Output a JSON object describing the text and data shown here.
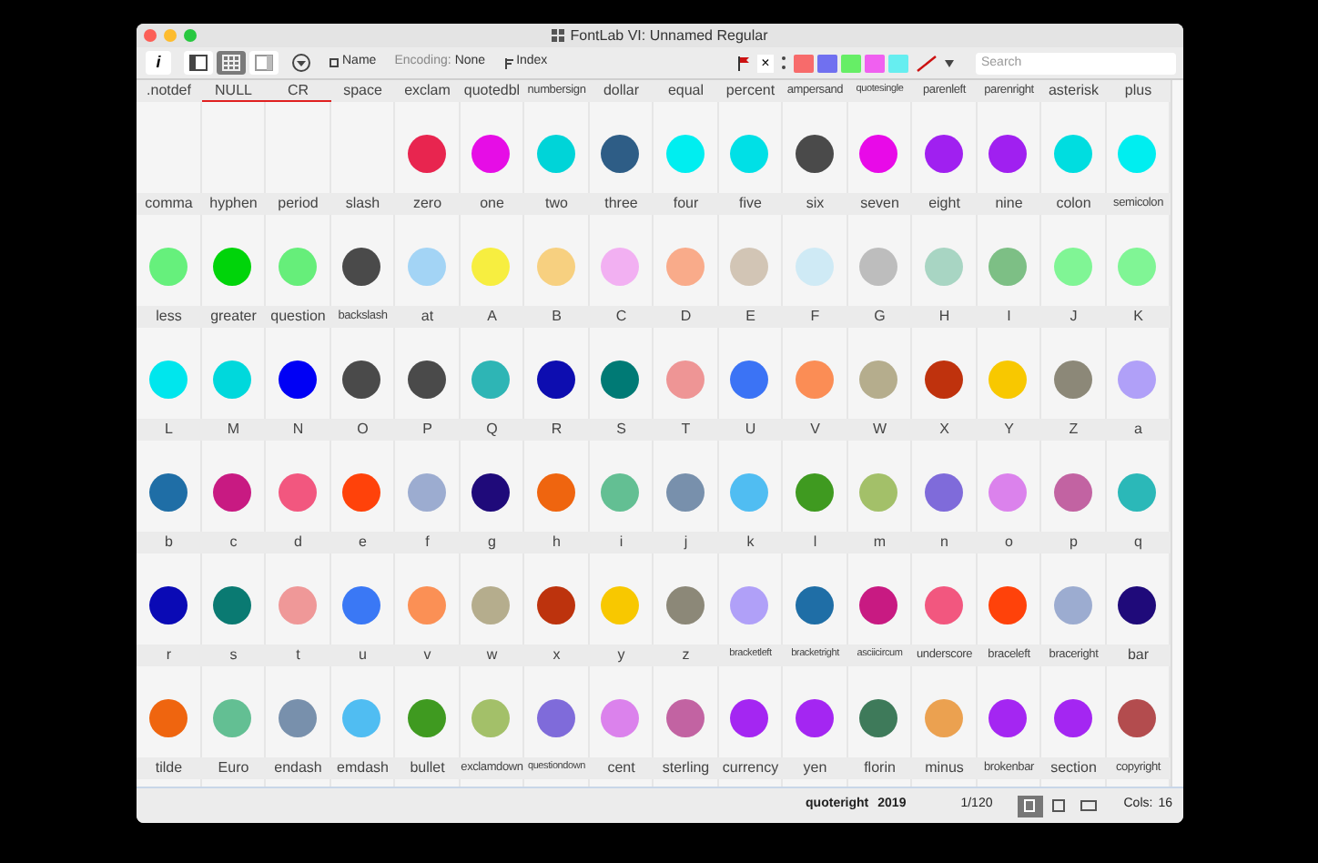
{
  "window": {
    "title": "FontLab VI: Unnamed Regular"
  },
  "toolbar": {
    "info_label": "i",
    "views": [
      {
        "selected": false
      },
      {
        "selected": true
      },
      {
        "selected": false
      }
    ],
    "name_label": "Name",
    "encoding_label": "Encoding:",
    "encoding_value": "None",
    "index_label": "Index",
    "clear_label": "×",
    "swatches": [
      {
        "color": "#f76b6b"
      },
      {
        "color": "#7070f0"
      },
      {
        "color": "#66ee66"
      },
      {
        "color": "#f060f0"
      },
      {
        "color": "#66eef0"
      }
    ],
    "search": {
      "placeholder": "Search"
    }
  },
  "glyph_rows": [
    [
      {
        "name": ".notdef",
        "marked": false
      },
      {
        "name": "NULL",
        "marked": true
      },
      {
        "name": "CR",
        "marked": true
      },
      {
        "name": "space",
        "marked": false
      },
      {
        "name": "exclam",
        "marked": false,
        "color": "#e8254f"
      },
      {
        "name": "quotedbl",
        "marked": false,
        "color": "#e60de6"
      },
      {
        "name": "numbersign",
        "marked": false,
        "color": "#00d4d8"
      },
      {
        "name": "dollar",
        "marked": false,
        "color": "#2e5d86"
      },
      {
        "name": "equal",
        "marked": false,
        "color": "#00eef0"
      },
      {
        "name": "percent",
        "marked": false,
        "color": "#00e0e6"
      },
      {
        "name": "ampersand",
        "marked": false,
        "color": "#4a4a4a"
      },
      {
        "name": "quotesingle",
        "marked": false,
        "color": "#e80ae8"
      },
      {
        "name": "parenleft",
        "marked": false,
        "color": "#a020f0"
      },
      {
        "name": "parenright",
        "marked": false,
        "color": "#a020f0"
      },
      {
        "name": "asterisk",
        "marked": false,
        "color": "#00dde0"
      },
      {
        "name": "plus",
        "marked": false,
        "color": "#00eef0"
      }
    ],
    [
      {
        "name": "comma",
        "marked": false,
        "color": "#66f07c"
      },
      {
        "name": "hyphen",
        "marked": false,
        "color": "#00d40a"
      },
      {
        "name": "period",
        "marked": false,
        "color": "#66ee7a"
      },
      {
        "name": "slash",
        "marked": false,
        "color": "#4a4a4a"
      },
      {
        "name": "zero",
        "marked": false,
        "color": "#a3d4f5"
      },
      {
        "name": "one",
        "marked": false,
        "color": "#f7ee40"
      },
      {
        "name": "two",
        "marked": false,
        "color": "#f7d080"
      },
      {
        "name": "three",
        "marked": false,
        "color": "#f2b0f2"
      },
      {
        "name": "four",
        "marked": false,
        "color": "#f9ab8a"
      },
      {
        "name": "five",
        "marked": false,
        "color": "#d2c5b5"
      },
      {
        "name": "six",
        "marked": false,
        "color": "#cfeaf5"
      },
      {
        "name": "seven",
        "marked": false,
        "color": "#bdbdbd"
      },
      {
        "name": "eight",
        "marked": false,
        "color": "#a8d5c3"
      },
      {
        "name": "nine",
        "marked": false,
        "color": "#7dbf85"
      },
      {
        "name": "colon",
        "marked": false,
        "color": "#80f595"
      },
      {
        "name": "semicolon",
        "marked": false,
        "color": "#80f595"
      }
    ],
    [
      {
        "name": "less",
        "marked": false,
        "color": "#00e6ed"
      },
      {
        "name": "greater",
        "marked": false,
        "color": "#00d8dc"
      },
      {
        "name": "question",
        "marked": false,
        "color": "#0000f5"
      },
      {
        "name": "backslash",
        "marked": false,
        "color": "#4a4a4a"
      },
      {
        "name": "at",
        "marked": false,
        "color": "#4a4a4a"
      },
      {
        "name": "A",
        "marked": false,
        "color": "#2eb5b5"
      },
      {
        "name": "B",
        "marked": false,
        "color": "#0d0db0"
      },
      {
        "name": "C",
        "marked": false,
        "color": "#007a75"
      },
      {
        "name": "D",
        "marked": false,
        "color": "#ee9595"
      },
      {
        "name": "E",
        "marked": false,
        "color": "#3b73f5"
      },
      {
        "name": "F",
        "marked": false,
        "color": "#fb8d55"
      },
      {
        "name": "G",
        "marked": false,
        "color": "#b5ad8d"
      },
      {
        "name": "H",
        "marked": false,
        "color": "#bf320d"
      },
      {
        "name": "I",
        "marked": false,
        "color": "#f8c800"
      },
      {
        "name": "J",
        "marked": false,
        "color": "#8c8878"
      },
      {
        "name": "K",
        "marked": false,
        "color": "#b0a0f8"
      }
    ],
    [
      {
        "name": "L",
        "marked": false,
        "color": "#1f6ea6"
      },
      {
        "name": "M",
        "marked": false,
        "color": "#c81a82"
      },
      {
        "name": "N",
        "marked": false,
        "color": "#f2577f"
      },
      {
        "name": "O",
        "marked": false,
        "color": "#ff420a"
      },
      {
        "name": "P",
        "marked": false,
        "color": "#9cacd0"
      },
      {
        "name": "Q",
        "marked": false,
        "color": "#1f0a7a"
      },
      {
        "name": "R",
        "marked": false,
        "color": "#ef650f"
      },
      {
        "name": "S",
        "marked": false,
        "color": "#63bf93"
      },
      {
        "name": "T",
        "marked": false,
        "color": "#7890ac"
      },
      {
        "name": "U",
        "marked": false,
        "color": "#50bdf2"
      },
      {
        "name": "V",
        "marked": false,
        "color": "#3f9a20"
      },
      {
        "name": "W",
        "marked": false,
        "color": "#a3c069"
      },
      {
        "name": "X",
        "marked": false,
        "color": "#7f6bda"
      },
      {
        "name": "Y",
        "marked": false,
        "color": "#db82ec"
      },
      {
        "name": "Z",
        "marked": false,
        "color": "#c263a2"
      },
      {
        "name": "a",
        "marked": false,
        "color": "#2bb8b8"
      }
    ],
    [
      {
        "name": "b",
        "marked": false,
        "color": "#0a0ab5"
      },
      {
        "name": "c",
        "marked": false,
        "color": "#0a7a72"
      },
      {
        "name": "d",
        "marked": false,
        "color": "#ef9898"
      },
      {
        "name": "e",
        "marked": false,
        "color": "#3a78f5"
      },
      {
        "name": "f",
        "marked": false,
        "color": "#fb9055"
      },
      {
        "name": "g",
        "marked": false,
        "color": "#b5ad8d"
      },
      {
        "name": "h",
        "marked": false,
        "color": "#bd330d"
      },
      {
        "name": "i",
        "marked": false,
        "color": "#f8c800"
      },
      {
        "name": "j",
        "marked": false,
        "color": "#8c8878"
      },
      {
        "name": "k",
        "marked": false,
        "color": "#b0a0f8"
      },
      {
        "name": "l",
        "marked": false,
        "color": "#1f6ea6"
      },
      {
        "name": "m",
        "marked": false,
        "color": "#c81a82"
      },
      {
        "name": "n",
        "marked": false,
        "color": "#f2577f"
      },
      {
        "name": "o",
        "marked": false,
        "color": "#ff420a"
      },
      {
        "name": "p",
        "marked": false,
        "color": "#9cacd0"
      },
      {
        "name": "q",
        "marked": false,
        "color": "#1f0a7a"
      }
    ],
    [
      {
        "name": "r",
        "marked": false,
        "color": "#ef650f"
      },
      {
        "name": "s",
        "marked": false,
        "color": "#63bf93"
      },
      {
        "name": "t",
        "marked": false,
        "color": "#7890ac"
      },
      {
        "name": "u",
        "marked": false,
        "color": "#50bdf2"
      },
      {
        "name": "v",
        "marked": false,
        "color": "#3f9a20"
      },
      {
        "name": "w",
        "marked": false,
        "color": "#a3c069"
      },
      {
        "name": "x",
        "marked": false,
        "color": "#7f6bda"
      },
      {
        "name": "y",
        "marked": false,
        "color": "#db82ec"
      },
      {
        "name": "z",
        "marked": false,
        "color": "#c263a2"
      },
      {
        "name": "bracketleft",
        "marked": false,
        "color": "#a426f2"
      },
      {
        "name": "bracketright",
        "marked": false,
        "color": "#a426f2"
      },
      {
        "name": "asciicircum",
        "marked": false,
        "color": "#3e7a5a"
      },
      {
        "name": "underscore",
        "marked": false,
        "color": "#eba150"
      },
      {
        "name": "braceleft",
        "marked": false,
        "color": "#a426f2"
      },
      {
        "name": "braceright",
        "marked": false,
        "color": "#a426f2"
      },
      {
        "name": "bar",
        "marked": false,
        "color": "#b34c4e"
      }
    ],
    [
      {
        "name": "tilde",
        "marked": false
      },
      {
        "name": "Euro",
        "marked": false
      },
      {
        "name": "endash",
        "marked": false
      },
      {
        "name": "emdash",
        "marked": false
      },
      {
        "name": "bullet",
        "marked": false
      },
      {
        "name": "exclamdown",
        "marked": false
      },
      {
        "name": "questiondown",
        "marked": false
      },
      {
        "name": "cent",
        "marked": false
      },
      {
        "name": "sterling",
        "marked": false
      },
      {
        "name": "currency",
        "marked": false
      },
      {
        "name": "yen",
        "marked": false
      },
      {
        "name": "florin",
        "marked": false
      },
      {
        "name": "minus",
        "marked": false
      },
      {
        "name": "brokenbar",
        "marked": false
      },
      {
        "name": "section",
        "marked": false
      },
      {
        "name": "copyright",
        "marked": false
      }
    ]
  ],
  "status_bar": {
    "glyph_name": "quoteright",
    "glyph_code": "2019",
    "position": "1/120",
    "views": [
      {
        "selected": true
      },
      {
        "selected": false
      },
      {
        "selected": false
      }
    ],
    "cols_label": "Cols:",
    "cols_value": "16"
  }
}
